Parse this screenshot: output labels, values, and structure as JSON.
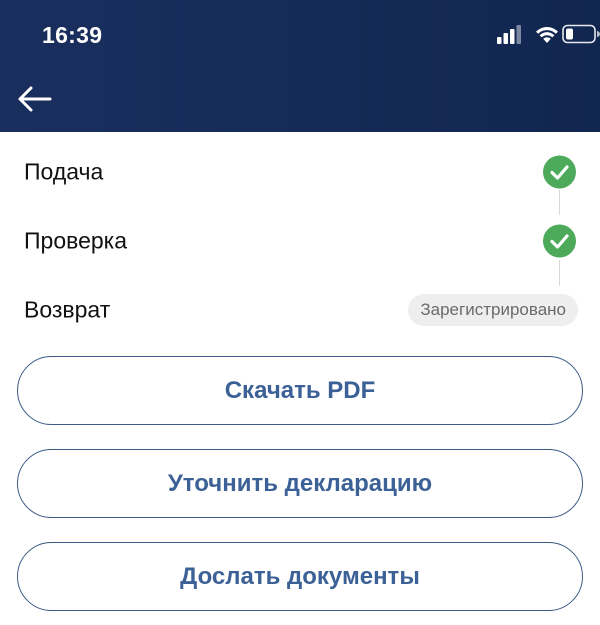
{
  "status_bar": {
    "time": "16:39",
    "icons": [
      "signal-icon",
      "wifi-icon",
      "battery-icon"
    ]
  },
  "header": {
    "back_icon": "arrow-left-icon",
    "background_color": "#152a56"
  },
  "steps": [
    {
      "label": "Подача",
      "state": "done"
    },
    {
      "label": "Проверка",
      "state": "done"
    },
    {
      "label": "Возврат",
      "state": "badge",
      "badge": "Зарегистрировано"
    }
  ],
  "actions": [
    {
      "label": "Скачать PDF"
    },
    {
      "label": "Уточнить декларацию"
    },
    {
      "label": "Дослать документы"
    }
  ],
  "colors": {
    "check_green": "#4caa5a",
    "button_text": "#3c6196",
    "button_border": "#3c5a85",
    "badge_bg": "#eeeeee"
  }
}
